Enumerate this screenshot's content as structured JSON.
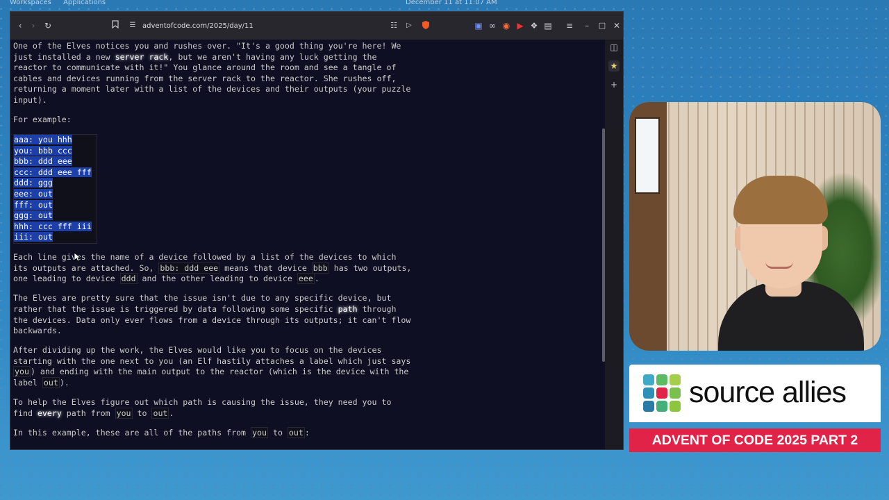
{
  "desktop": {
    "menu": [
      "Workspaces",
      "Applications"
    ],
    "clock": "December 11 at 11:07 AM"
  },
  "browser": {
    "url": "adventofcode.com/2025/day/11",
    "icons": [
      "back-icon",
      "forward-icon",
      "reload-icon",
      "bookmark-icon",
      "site-info-icon",
      "reader-view-icon",
      "play-icon",
      "brave-shield-icon",
      "extension-icons",
      "menu-icon",
      "minimize-icon",
      "maximize-icon",
      "close-icon"
    ]
  },
  "article": {
    "intro": [
      "One of the Elves notices you and rushes over. \"It's a good thing you're here! We just installed a new ",
      "server rack",
      ", but we aren't having any luck getting the reactor to communicate with it!\" You glance around the room and see a tangle of cables and devices running from the server rack to the reactor. She rushes off, returning a moment later with a list of the devices and their outputs (your puzzle input)."
    ],
    "for_example": "For example:",
    "example_lines": [
      "aaa: you hhh",
      "you: bbb ccc",
      "bbb: ddd eee",
      "ccc: ddd eee fff",
      "ddd: ggg",
      "eee: out",
      "fff: out",
      "ggg: out",
      "hhh: ccc fff iii",
      "iii: out"
    ],
    "p2": {
      "a": "Each line gives the name of a device followed by a list of the devices to which its outputs are attached. So, ",
      "code1": "bbb: ddd eee",
      "b": " means that device ",
      "code2": "bbb",
      "c": " has two outputs, one leading to device ",
      "code3": "ddd",
      "d": " and the other leading to device ",
      "code4": "eee",
      "e": "."
    },
    "p3": {
      "a": "The Elves are pretty sure that the issue isn't due to any specific device, but rather that the issue is triggered by data following some specific ",
      "em": "path",
      "b": " through the devices. Data only ever flows from a device through its outputs; it can't flow backwards."
    },
    "p4": {
      "a": "After dividing up the work, the Elves would like you to focus on the devices starting with the one next to you (an Elf hastily attaches a label which just says ",
      "code1": "you",
      "b": ") and ending with the main output to the reactor (which is the device with the label ",
      "code2": "out",
      "c": ")."
    },
    "p5": {
      "a": "To help the Elves figure out which path is causing the issue, they need you to find ",
      "em": "every",
      "b": " path from ",
      "code1": "you",
      "c": " to ",
      "code2": "out",
      "d": "."
    },
    "p6": {
      "a": "In this example, these are all of the paths from ",
      "code1": "you",
      "b": " to ",
      "code2": "out",
      "c": ":"
    }
  },
  "overlay": {
    "brand_name": "source allies",
    "banner": "ADVENT OF CODE 2025 PART 2",
    "colors": {
      "banner": "#e02346",
      "brand_bg": "#ffffff",
      "aoc_bg": "#0f0f23",
      "selection": "#1c3fa9"
    }
  }
}
